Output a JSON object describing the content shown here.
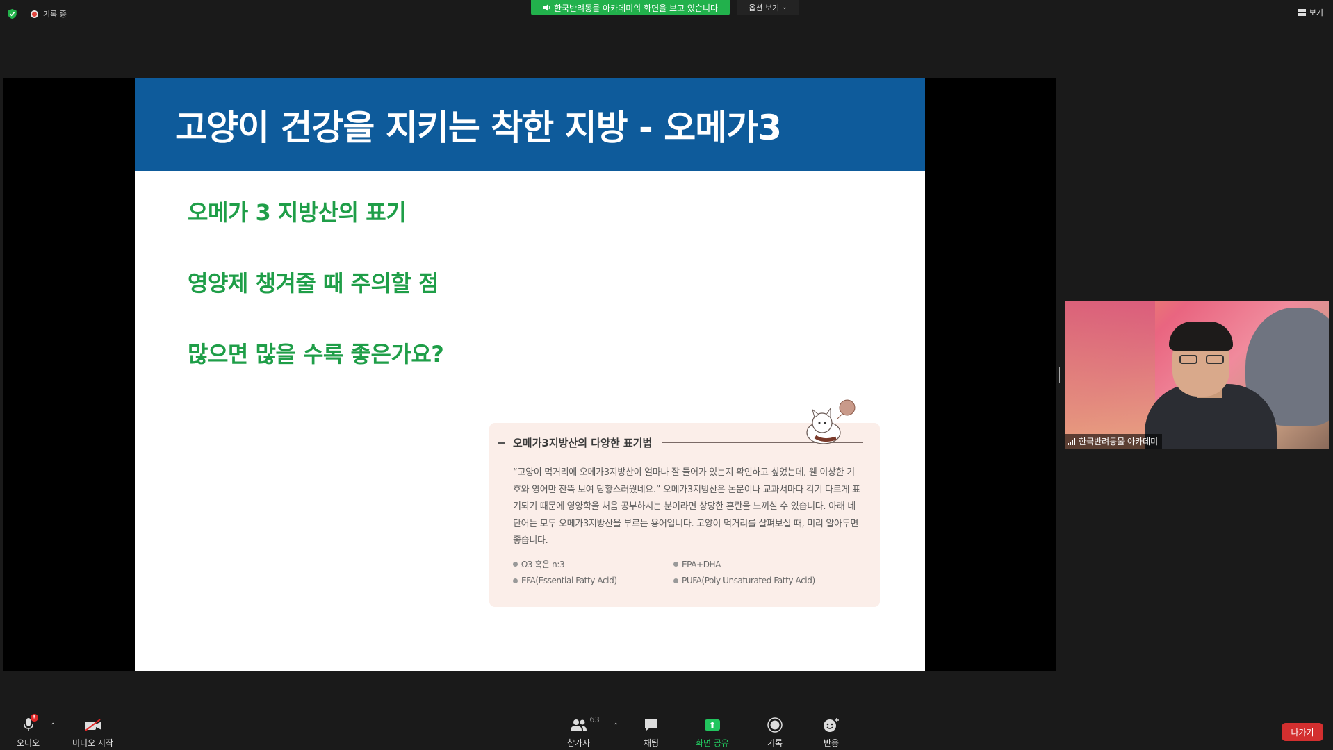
{
  "top_bar": {
    "recording_label": "기록 중",
    "share_banner": "한국반려동물 아카데미의 화면을 보고 있습니다",
    "options_label": "옵션 보기",
    "view_label": "보기"
  },
  "slide": {
    "title": "고양이 건강을 지키는 착한 지방 - 오메가3",
    "points": [
      "오메가 3 지방산의 표기",
      "영양제 챙겨줄 때 주의할 점",
      "많으면 많을 수록 좋은가요?"
    ],
    "card": {
      "title": "오메가3지방산의 다양한 표기법",
      "body": "“고양이 먹거리에 오메가3지방산이 얼마나 잘 들어가 있는지 확인하고 싶었는데, 웬 이상한 기호와 영어만 잔뜩 보여 당황스러웠네요.” 오메가3지방산은 논문이나 교과서마다 각기 다르게 표기되기 때문에 영양학을 처음 공부하시는 분이라면 상당한 혼란을 느끼실 수 있습니다. 아래 네 단어는 모두 오메가3지방산을 부르는 용어입니다. 고양이 먹거리를 살펴보실 때, 미리 알아두면 좋습니다.",
      "terms": [
        "Ω3 혹은 n:3",
        "EPA+DHA",
        "EFA(Essential Fatty Acid)",
        "PUFA(Poly Unsaturated Fatty Acid)"
      ]
    }
  },
  "video": {
    "participant_name": "한국반려동물 아카데미"
  },
  "toolbar": {
    "audio_label": "오디오",
    "audio_badge": "!",
    "video_label": "비디오 시작",
    "participants_label": "참가자",
    "participants_count": "63",
    "chat_label": "채팅",
    "share_label": "화면 공유",
    "record_label": "기록",
    "reactions_label": "반응",
    "leave_label": "나가기"
  },
  "colors": {
    "slide_header": "#0e5b9b",
    "slide_point_text": "#1f9e48",
    "share_banner": "#22b14c",
    "leave_button": "#d32f2f",
    "share_label": "#22c55e"
  }
}
